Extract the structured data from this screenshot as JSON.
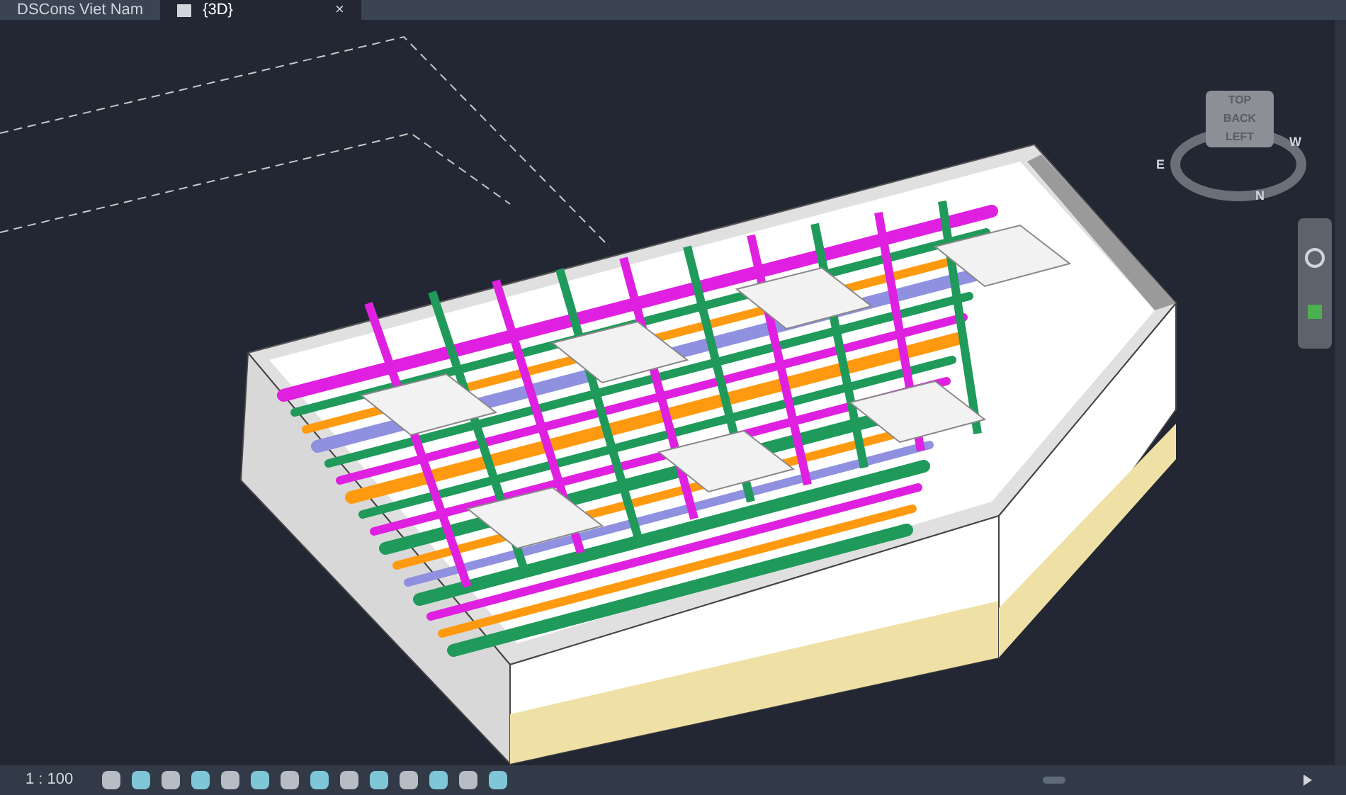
{
  "tabs": [
    {
      "label": "DSCons Viet Nam",
      "selected": false
    },
    {
      "label": "{3D}",
      "selected": true,
      "close": "×"
    }
  ],
  "viewcube": {
    "faces": [
      "TOP",
      "BACK",
      "LEFT"
    ],
    "compass": [
      "E",
      "N",
      "W"
    ]
  },
  "status_bar": {
    "scale": "1 : 100"
  }
}
